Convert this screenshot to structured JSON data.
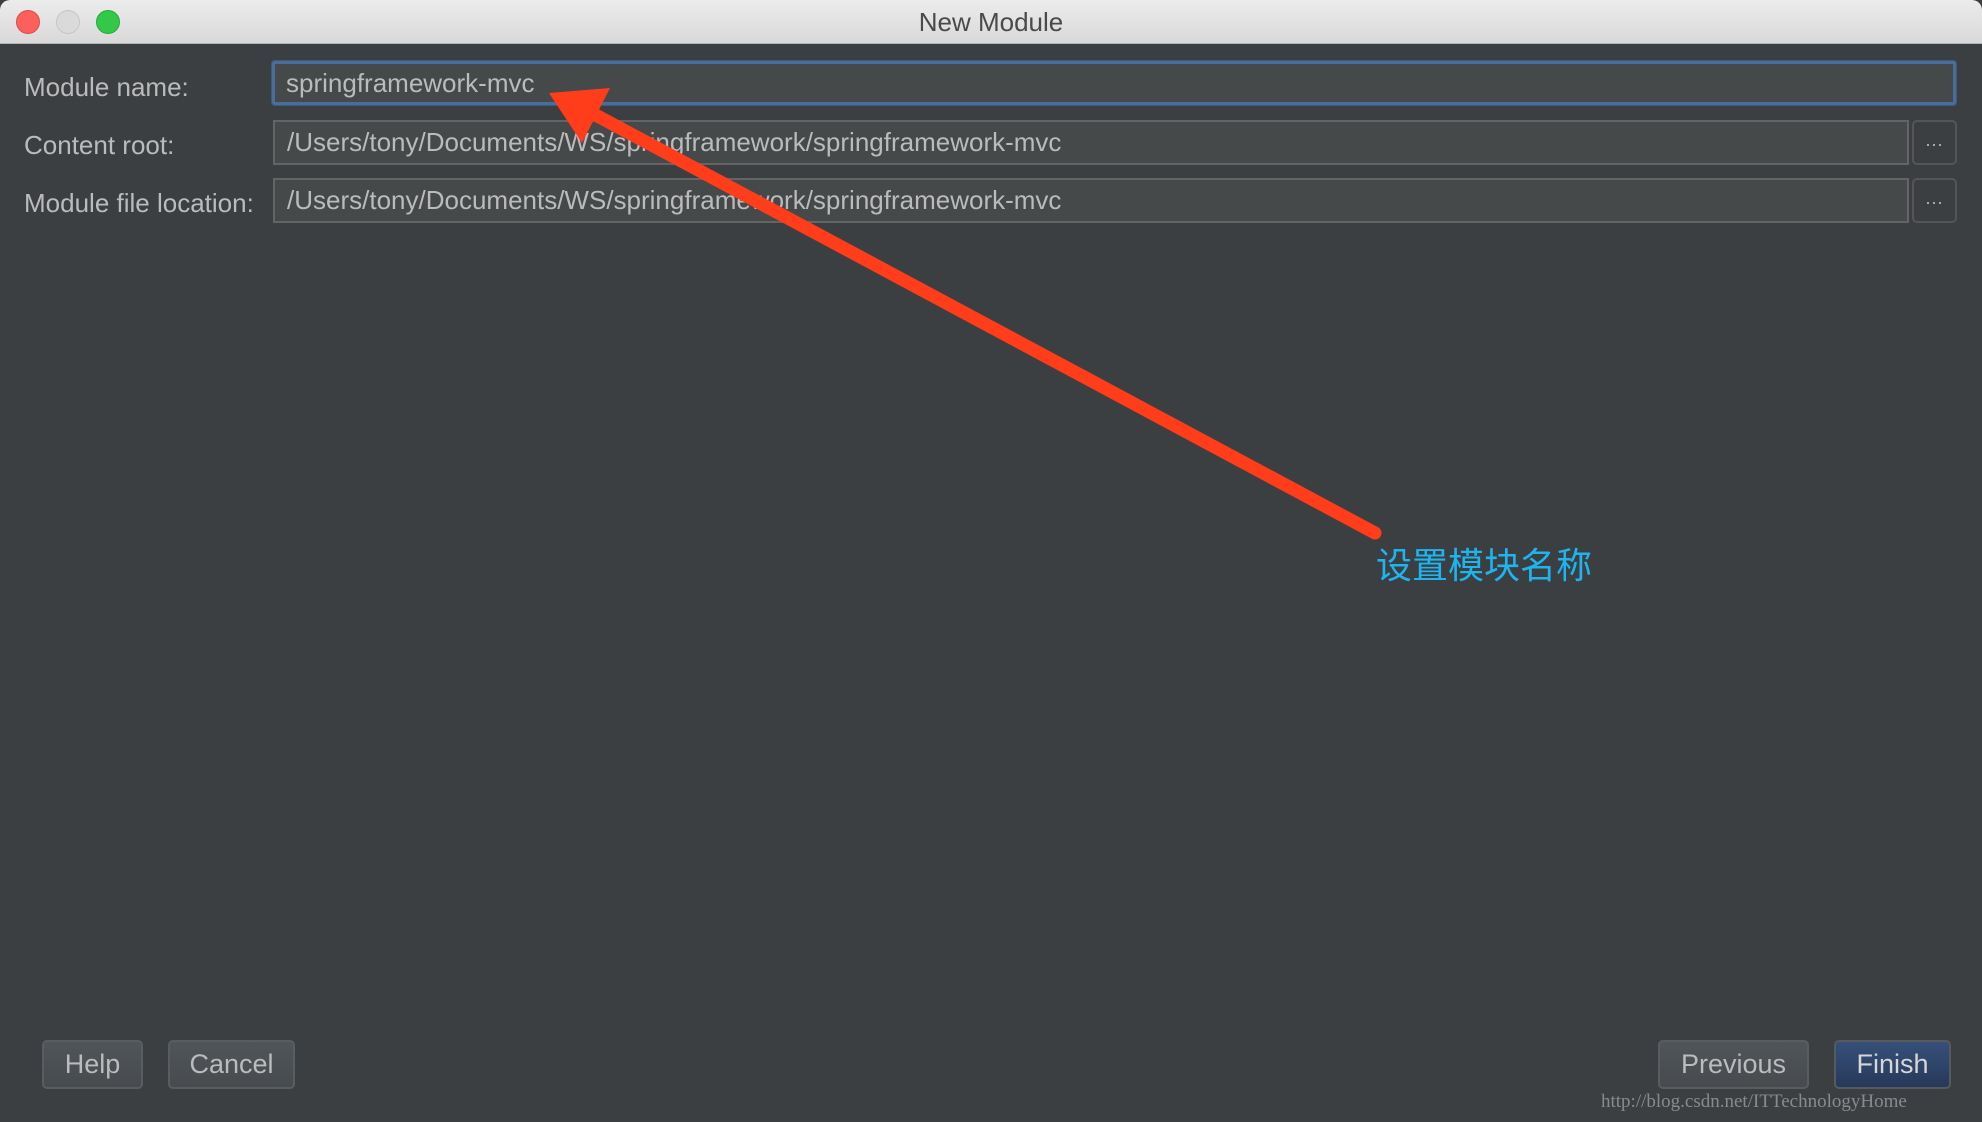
{
  "window": {
    "title": "New Module",
    "controls": [
      "close",
      "minimize",
      "zoom"
    ]
  },
  "form": {
    "module_name": {
      "label": "Module name:",
      "value": "springframework-mvc"
    },
    "content_root": {
      "label": "Content root:",
      "value": "/Users/tony/Documents/WS/springframework/springframework-mvc",
      "browse_label": "..."
    },
    "module_file_location": {
      "label": "Module file location:",
      "value": "/Users/tony/Documents/WS/springframework/springframework-mvc",
      "browse_label": "..."
    }
  },
  "buttons": {
    "help": "Help",
    "cancel": "Cancel",
    "previous": "Previous",
    "finish": "Finish"
  },
  "annotation": {
    "text": "设置模块名称",
    "arrow_color": "#ff3d1a",
    "text_color": "#1eb4f0"
  },
  "watermark": "http://blog.csdn.net/ITTechnologyHome"
}
